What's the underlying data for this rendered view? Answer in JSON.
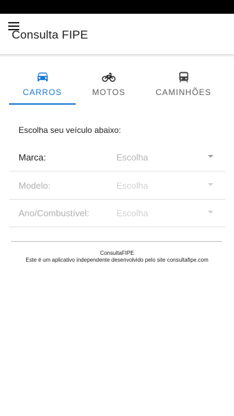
{
  "app_bar": {
    "title": "Consulta FIPE",
    "menu_icon": "menu-icon"
  },
  "tabs": [
    {
      "label": "CARROS",
      "icon": "car-icon",
      "active": true
    },
    {
      "label": "MOTOS",
      "icon": "bicycle-icon",
      "active": false
    },
    {
      "label": "CAMINHÕES",
      "icon": "bus-icon",
      "active": false
    }
  ],
  "form": {
    "heading": "Escolha seu veículo abaixo:",
    "fields": [
      {
        "label": "Marca:",
        "value": "Escolha",
        "enabled": true
      },
      {
        "label": "Modelo:",
        "value": "Escolha",
        "enabled": false
      },
      {
        "label": "Ano/Combustível:",
        "value": "Escolha",
        "enabled": false
      }
    ]
  },
  "footer": {
    "app_name": "ConsultaFIPE",
    "description": "Este é um aplicativo independente desenvolvido pelo site consultafipe.com"
  },
  "colors": {
    "accent": "#1976d2",
    "status_bar": "#000000",
    "disabled_text": "#b0b0b0"
  }
}
